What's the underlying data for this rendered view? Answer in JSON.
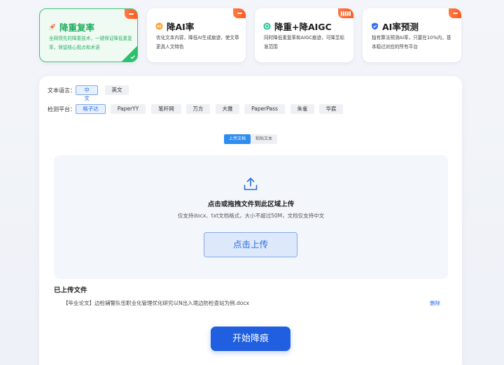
{
  "cards": [
    {
      "title": "降重复率",
      "desc": "全网领先的降重技术，一键保证降低重复率，保留核心观点和术语",
      "icon": "rocket-icon",
      "active": true
    },
    {
      "title": "降AI率",
      "desc": "优化文本内容，降低AI生成痕迹，使文章更具人文特色",
      "icon": "ai-badge-icon",
      "active": false
    },
    {
      "title": "降重+降AIGC",
      "desc": "同时降低重复率和AIGC痕迹，可降至标准范围",
      "icon": "combo-icon",
      "active": false
    },
    {
      "title": "AI率预测",
      "desc": "独有算法预测AI率，只要在10%内，基本稳过对应的所有平台",
      "icon": "shield-icon",
      "active": false
    }
  ],
  "language": {
    "label": "文本语言：",
    "options": [
      "中文",
      "英文"
    ],
    "selected": "中文"
  },
  "platform": {
    "label": "检测平台：",
    "options": [
      "格子达",
      "PaperYY",
      "笔杆网",
      "万方",
      "大雅",
      "PaperPass",
      "朱雀",
      "华宸"
    ],
    "selected": "格子达"
  },
  "mode_tabs": {
    "upload": "上传文档",
    "paste": "粘贴文本",
    "selected": "上传文档"
  },
  "dropzone": {
    "heading": "点击或拖拽文件到此区域上传",
    "hint": "仅支持docx、txt文档格式，大小不超过50M，文档仅支持中文",
    "button": "点击上传"
  },
  "uploaded": {
    "heading": "已上传文件",
    "file_name": "【毕业论文】边检辅警队伍职业化管理优化研究以N出入境边防检查站为例.docx",
    "delete_label": "删除"
  },
  "start_button": "开始降痕",
  "colors": {
    "accent": "#1f5fe0",
    "green": "#2cbf6c",
    "tag": "#ff5a1f"
  }
}
